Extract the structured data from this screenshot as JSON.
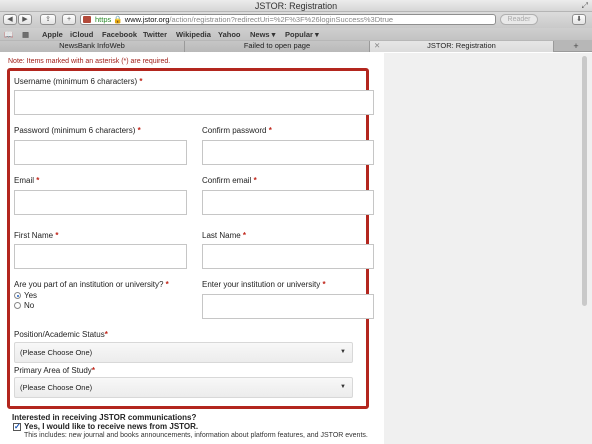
{
  "window": {
    "title": "JSTOR: Registration"
  },
  "toolbar": {
    "back": "◀",
    "forward": "▶",
    "share": "⇪",
    "add": "+",
    "url_scheme": "https",
    "url_host": "www.jstor.org",
    "url_path": "/action/registration?redirectUri=%2F%3F%26loginSuccess%3Dtrue",
    "reader": "Reader",
    "download": "⬇"
  },
  "bookmarks": [
    {
      "label": "Apple"
    },
    {
      "label": "iCloud"
    },
    {
      "label": "Facebook"
    },
    {
      "label": "Twitter"
    },
    {
      "label": "Wikipedia"
    },
    {
      "label": "Yahoo"
    },
    {
      "label": "News ▾"
    },
    {
      "label": "Popular ▾"
    }
  ],
  "tabs": [
    {
      "label": "NewsBank InfoWeb"
    },
    {
      "label": "Failed to open page"
    },
    {
      "label": "JSTOR: Registration"
    }
  ],
  "form": {
    "note": "Note: Items marked with an asterisk (*) are required.",
    "username_label": "Username (minimum 6 characters)",
    "password_label": "Password (minimum 6 characters)",
    "confirm_password_label": "Confirm password",
    "email_label": "Email",
    "confirm_email_label": "Confirm email",
    "first_name_label": "First Name",
    "last_name_label": "Last Name",
    "institution_question": "Are you part of an institution or university?",
    "institution_yes": "Yes",
    "institution_no": "No",
    "institution_selected": "Yes",
    "institution_name_label": "Enter your institution or university",
    "position_label": "Position/Academic Status",
    "position_value": "(Please Choose One)",
    "study_label": "Primary Area of Study",
    "study_value": "(Please Choose One)",
    "asterisk": "*"
  },
  "communications": {
    "heading": "Interested in receiving JSTOR communications?",
    "optin_label": "Yes, I would like to receive news from JSTOR.",
    "optin_checked": true,
    "description": "This includes: new journal and books announcements, information about platform features, and JSTOR events."
  },
  "colors": {
    "required": "#c0261b",
    "highlight_box": "#b3261e"
  }
}
